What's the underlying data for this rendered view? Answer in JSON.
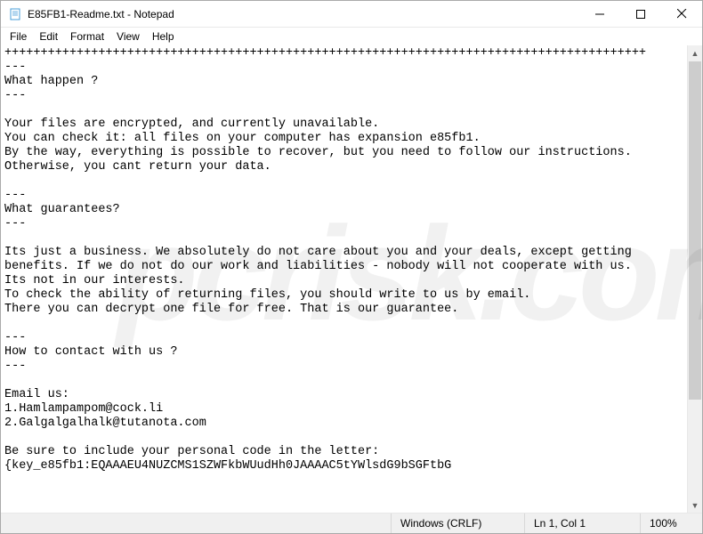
{
  "window": {
    "title": "E85FB1-Readme.txt - Notepad"
  },
  "menu": {
    "file": "File",
    "edit": "Edit",
    "format": "Format",
    "view": "View",
    "help": "Help"
  },
  "content": {
    "text": "+++++++++++++++++++++++++++++++++++++++++++++++++++++++++++++++++++++++++++++++++++++++++\n---\nWhat happen ?\n---\n\nYour files are encrypted, and currently unavailable.\nYou can check it: all files on your computer has expansion e85fb1.\nBy the way, everything is possible to recover, but you need to follow our instructions.\nOtherwise, you cant return your data.\n\n---\nWhat guarantees?\n---\n\nIts just a business. We absolutely do not care about you and your deals, except getting\nbenefits. If we do not do our work and liabilities - nobody will not cooperate with us.\nIts not in our interests.\nTo check the ability of returning files, you should write to us by email.\nThere you can decrypt one file for free. That is our guarantee.\n\n---\nHow to contact with us ?\n---\n\nEmail us:\n1.Hamlampampom@cock.li\n2.Galgalgalhalk@tutanota.com\n\nBe sure to include your personal code in the letter:\n{key_e85fb1:EQAAAEU4NUZCMS1SZWFkbWUudHh0JAAAAC5tYWlsdG9bSGFtbG"
  },
  "statusbar": {
    "encoding": "Windows (CRLF)",
    "position": "Ln 1, Col 1",
    "zoom": "100%"
  },
  "watermark": "pcrisk.com"
}
